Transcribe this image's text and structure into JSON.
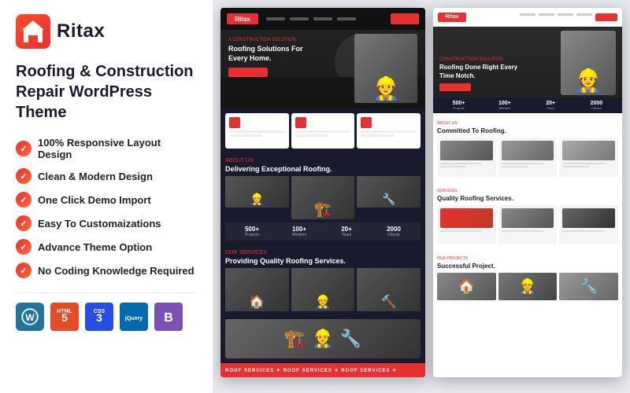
{
  "brand": {
    "name": "Ritax"
  },
  "theme": {
    "title": "Roofing & Construction Repair WordPress Theme"
  },
  "features": [
    {
      "id": "responsive",
      "text": "100% Responsive Layout Design"
    },
    {
      "id": "clean",
      "text": "Clean & Modern Design"
    },
    {
      "id": "demo",
      "text": "One Click Demo Import"
    },
    {
      "id": "customization",
      "text": "Easy To Customaizations"
    },
    {
      "id": "advance",
      "text": "Advance Theme Option"
    },
    {
      "id": "nocoding",
      "text": "No Coding Knowledge Required"
    }
  ],
  "badges": [
    {
      "id": "wp",
      "label": "WP",
      "title": "WordPress"
    },
    {
      "id": "html5",
      "label": "5",
      "title": "HTML5"
    },
    {
      "id": "css3",
      "label": "3",
      "title": "CSS3"
    },
    {
      "id": "jquery",
      "label": "jQuery",
      "title": "jQuery"
    },
    {
      "id": "bootstrap",
      "label": "B",
      "title": "Bootstrap"
    }
  ],
  "preview_left": {
    "brand": "Ritax",
    "hero_tag": "A Construction Solution",
    "hero_title": "Roofing Solutions For Every Home.",
    "section_tag": "About Us",
    "section_heading": "Delivering Exceptional Roofing.",
    "section2_tag": "Our Services",
    "section2_heading": "Providing Quality Roofing Services.",
    "stats": [
      {
        "num": "500+",
        "label": "Projects"
      },
      {
        "num": "100+",
        "label": "Workers"
      },
      {
        "num": "20+",
        "label": "Years"
      },
      {
        "num": "2000",
        "label": "Clients"
      }
    ],
    "ticker": "ROOF SERVICES ✦ ROOF SERVICES ✦ ROOF SERVICES ✦"
  },
  "preview_right": {
    "brand": "Ritax",
    "hero_title": "Roofing Done Right Every Time Notch.",
    "section_tag": "About Us",
    "section_heading": "Committed To Roofing.",
    "section2_tag": "Services",
    "section2_heading": "Quality Roofing Services.",
    "stats": [
      {
        "num": "500+",
        "label": "Projects"
      },
      {
        "num": "100+",
        "label": "Workers"
      },
      {
        "num": "20+",
        "label": "Years"
      },
      {
        "num": "2000",
        "label": "Clients"
      }
    ],
    "bottom_heading": "Successful Project."
  },
  "colors": {
    "accent": "#e83030",
    "dark": "#1a1a2e",
    "light": "#fff"
  }
}
